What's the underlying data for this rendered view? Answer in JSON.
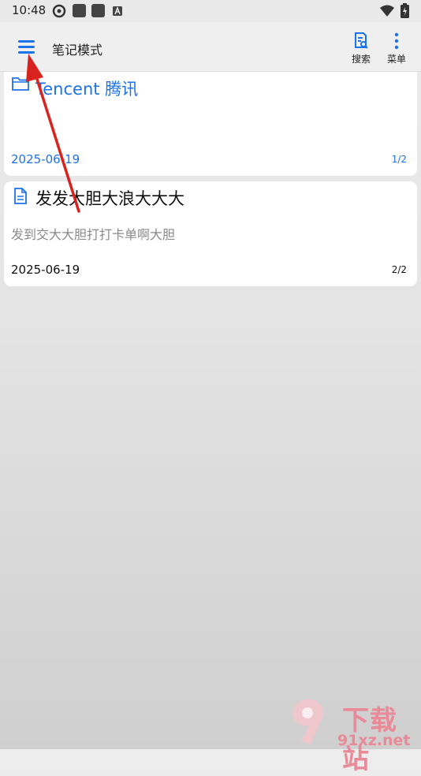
{
  "status_bar": {
    "time": "10:48"
  },
  "top_bar": {
    "title": "笔记模式",
    "search_label": "搜索",
    "menu_label": "菜单"
  },
  "cards": [
    {
      "title": "Tencent 腾讯",
      "preview": "",
      "date": "2025-06-19",
      "page": "1/2",
      "kind": "folder",
      "accent": "#1a73e8"
    },
    {
      "title": "发发大胆大浪大大大",
      "preview": "发到交大大胆打打卡单啊大胆",
      "date": "2025-06-19",
      "page": "2/2",
      "kind": "note"
    }
  ],
  "colors": {
    "accent": "#1a73e8",
    "arrow": "#d9231f"
  },
  "watermark": {
    "brand": "下载站",
    "site": "91xz.net"
  }
}
